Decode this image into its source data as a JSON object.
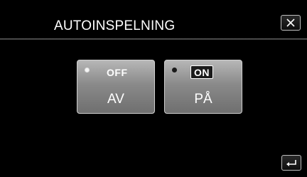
{
  "header": {
    "title": "AUTOINSPELNING",
    "close_icon": "close-icon"
  },
  "options": [
    {
      "badge": "OFF",
      "label": "AV",
      "selected": false
    },
    {
      "badge": "ON",
      "label": "PÅ",
      "selected": true
    }
  ],
  "footer": {
    "back_icon": "return-arrow-icon"
  },
  "colors": {
    "background": "#000000",
    "button_face": "#8a8a8a",
    "text": "#ffffff"
  }
}
